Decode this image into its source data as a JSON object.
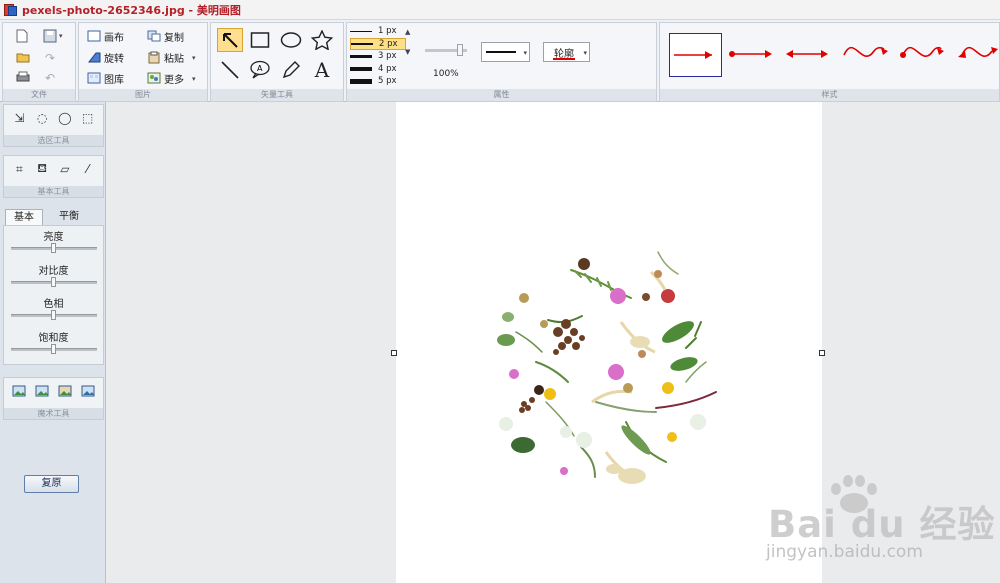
{
  "window": {
    "title": "pexels-photo-2652346.jpg - 美明画图"
  },
  "ribbon": {
    "groups": {
      "file": "文件",
      "picture": "图片",
      "vector": "矢量工具",
      "attributes": "属性",
      "style": "样式"
    },
    "picture_buttons": {
      "canvas": "画布",
      "rotate": "旋转",
      "gallery": "图库",
      "copy": "复制",
      "paste": "粘贴",
      "more": "更多"
    },
    "line_widths": [
      "1 px",
      "2 px",
      "3 px",
      "4 px",
      "5 px"
    ],
    "selected_line_width": "2 px",
    "opacity": "100%",
    "outline_label": "轮廓",
    "accent_color": "#e00000"
  },
  "left_panel": {
    "select_tools": "选区工具",
    "basic_tools": "基本工具",
    "magic_tools": "魔术工具",
    "tabs": [
      "基本",
      "平衡"
    ],
    "adjustments": [
      "亮度",
      "对比度",
      "色相",
      "饱和度"
    ],
    "reset": "复原"
  },
  "watermark": {
    "brand": "Bai du 经验",
    "url": "jingyan.baidu.com"
  }
}
